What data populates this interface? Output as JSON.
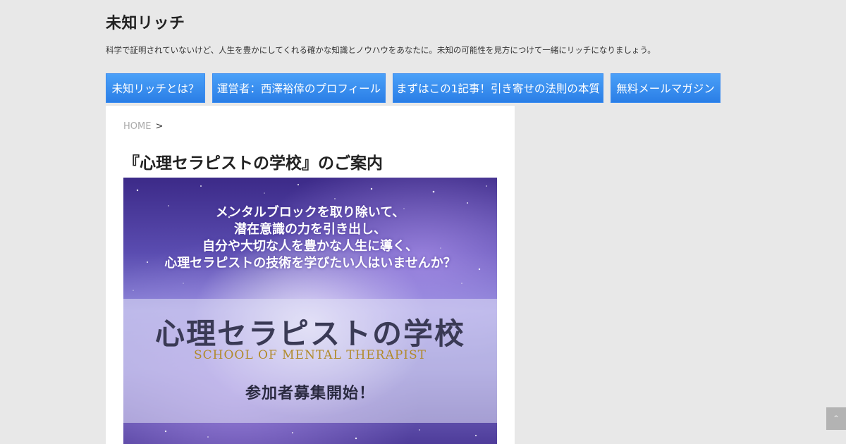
{
  "site": {
    "title": "未知リッチ",
    "description": "科学で証明されていないけど、人生を豊かにしてくれる確かな知識とノウハウをあなたに。未知の可能性を見方につけて一緒にリッチになりましょう。"
  },
  "nav": {
    "items": [
      {
        "label": "未知リッチとは？"
      },
      {
        "label": "運営者：西澤裕倖のプロフィール"
      },
      {
        "label": "まずはこの1記事！引き寄せの法則の本質"
      },
      {
        "label": "無料メールマガジン"
      }
    ]
  },
  "breadcrumb": {
    "home": "HOME",
    "separator": ">"
  },
  "page": {
    "title": "『心理セラピストの学校』のご案内"
  },
  "hero": {
    "lines": [
      "メンタルブロックを取り除いて、",
      "潜在意識の力を引き出し、",
      "自分や大切な人を豊かな人生に導く、",
      "心理セラピストの技術を学びたい人はいませんか？"
    ],
    "title": "心理セラピストの学校",
    "subtitle": "SCHOOL OF MENTAL THERAPIST",
    "cta": "参加者募集開始！"
  },
  "to_top": {
    "icon": "chevron-up-icon",
    "symbol": "^"
  },
  "colors": {
    "background": "#e8e8e8",
    "nav_button": "#3a8ef0",
    "hero_gold": "#b18a2a"
  }
}
